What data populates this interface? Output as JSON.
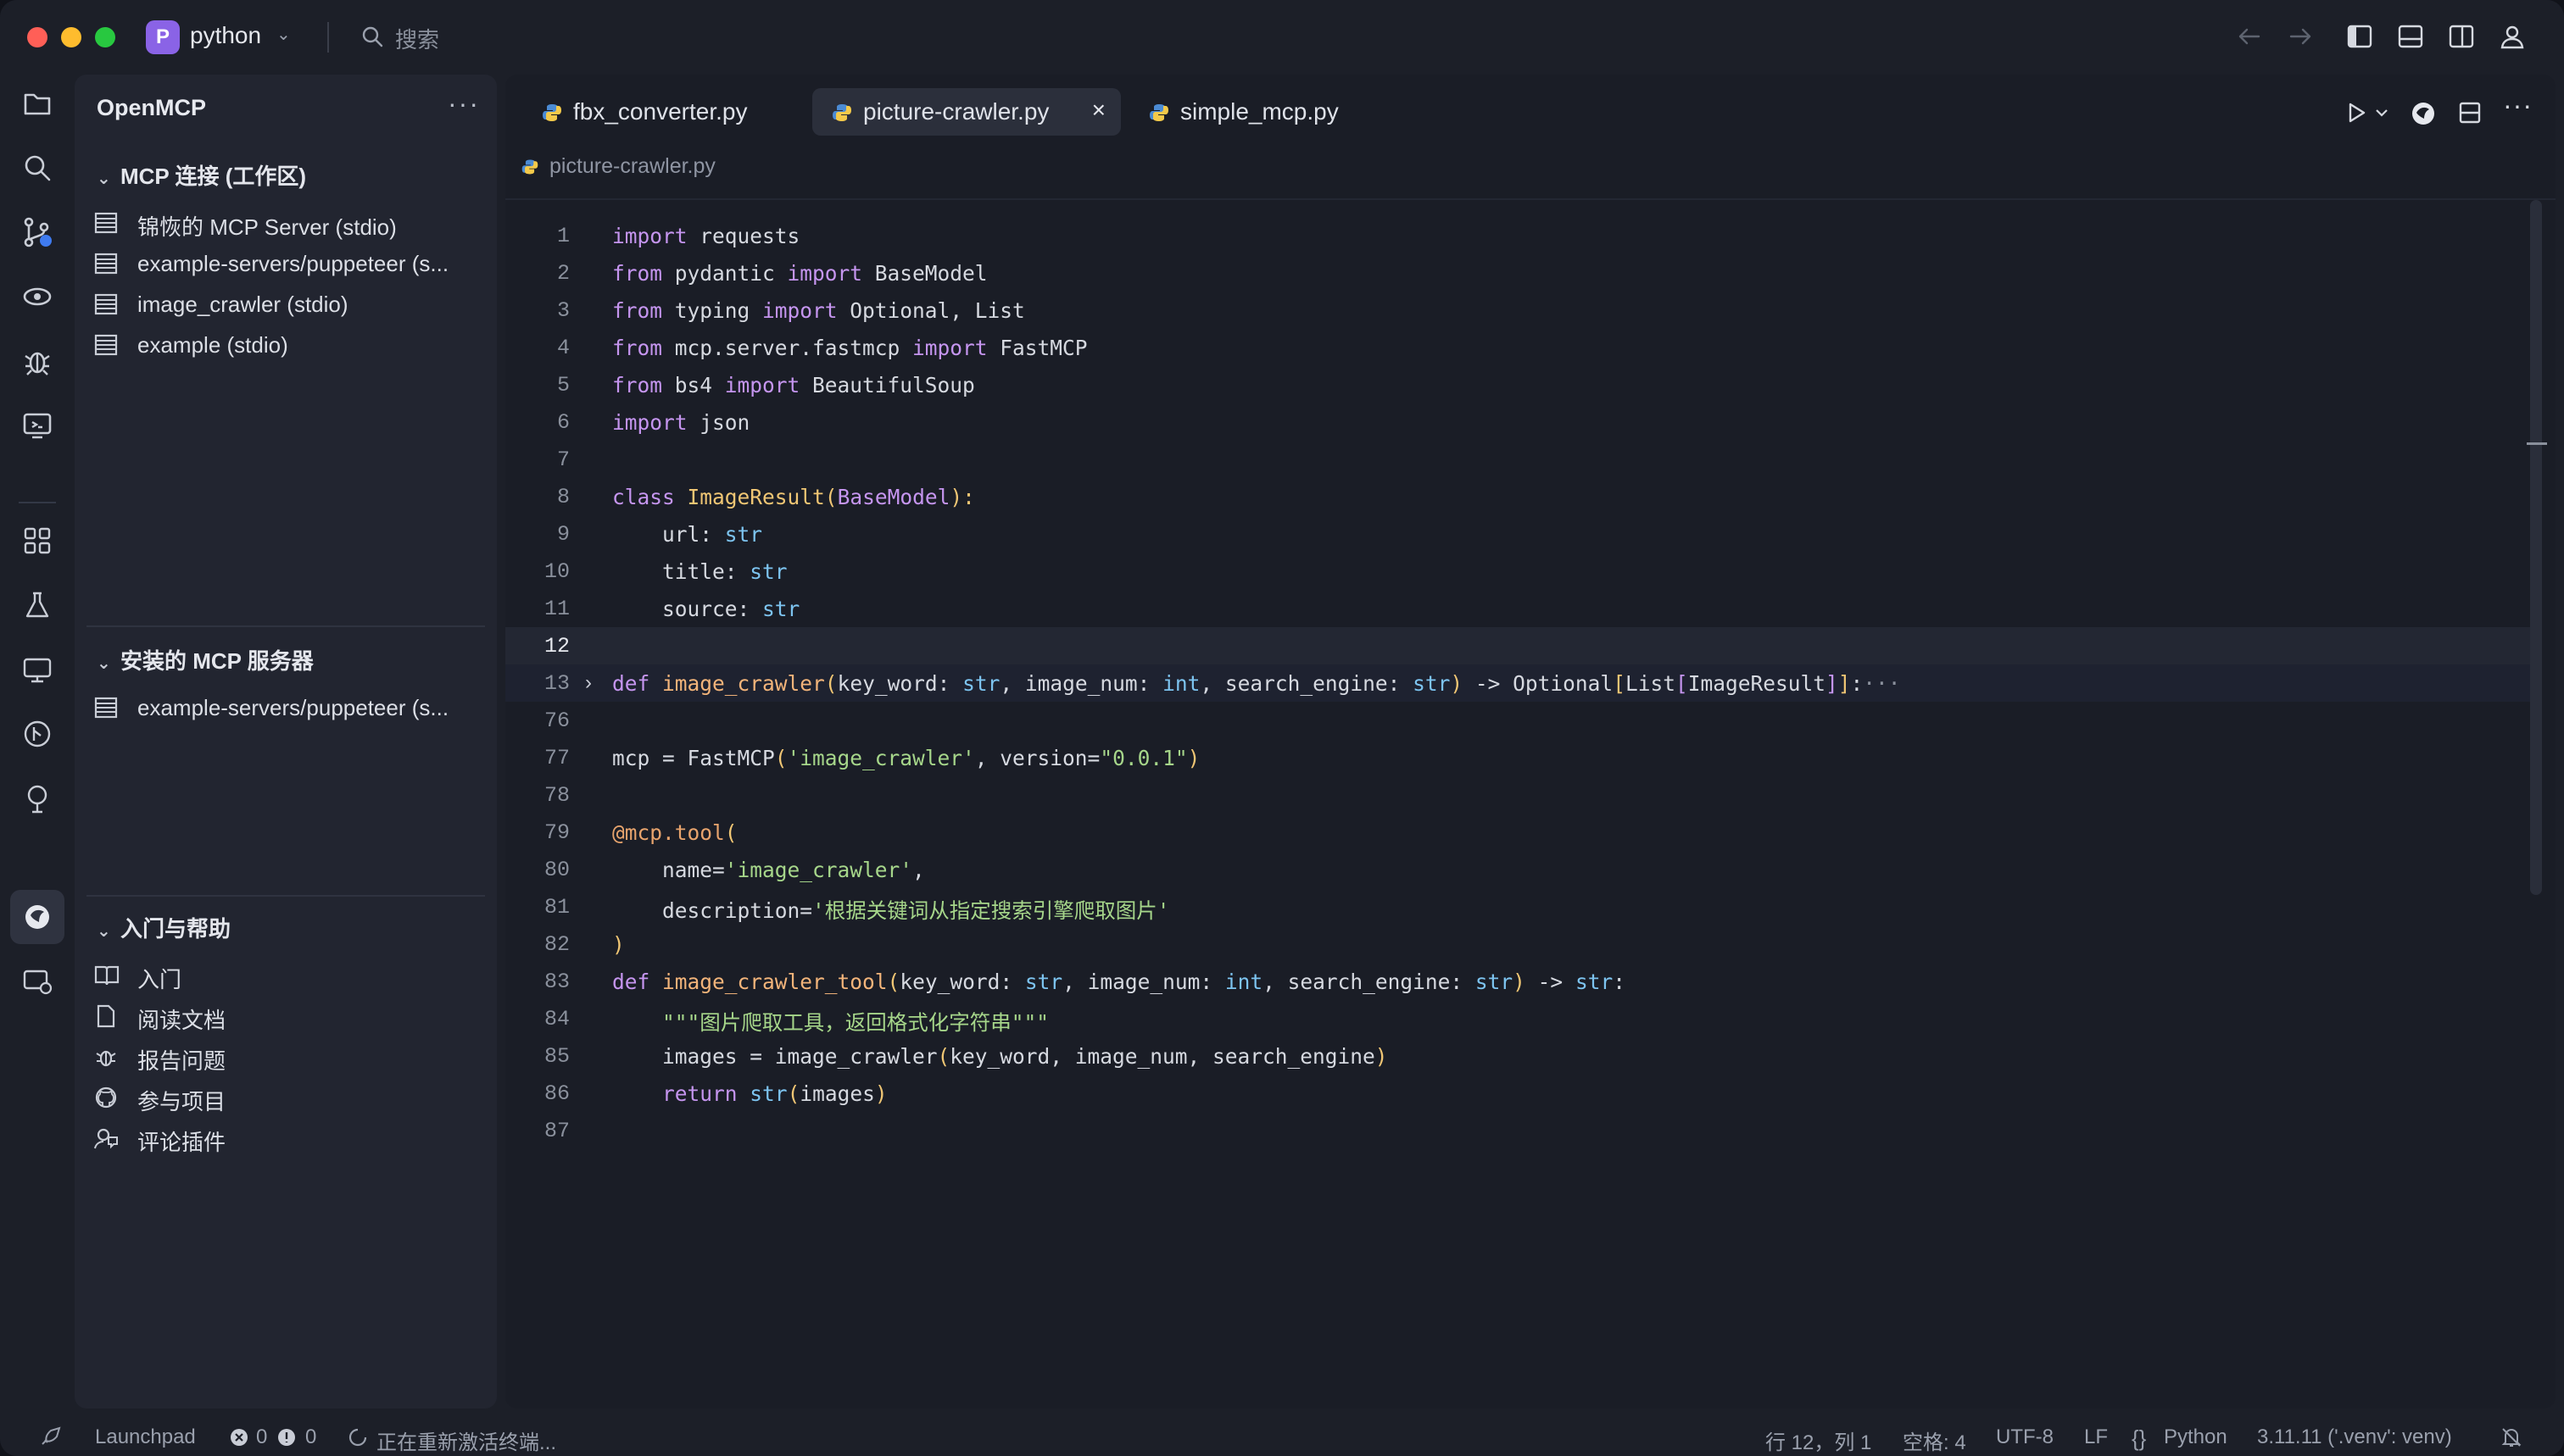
{
  "titlebar": {
    "project_initial": "P",
    "project_name": "python",
    "search_placeholder": "搜索"
  },
  "sidebar": {
    "title": "OpenMCP",
    "more": "···",
    "sections": {
      "connections": {
        "title": "MCP 连接 (工作区)",
        "items": [
          "锦恢的 MCP Server (stdio)",
          "example-servers/puppeteer (s...",
          "image_crawler (stdio)",
          "example (stdio)"
        ]
      },
      "installed": {
        "title": "安装的 MCP 服务器",
        "items": [
          "example-servers/puppeteer (s..."
        ]
      },
      "help": {
        "title": "入门与帮助",
        "items": [
          "入门",
          "阅读文档",
          "报告问题",
          "参与项目",
          "评论插件"
        ]
      }
    }
  },
  "editor": {
    "tabs": [
      {
        "label": "fbx_converter.py",
        "active": false
      },
      {
        "label": "picture-crawler.py",
        "active": true,
        "close": "×"
      },
      {
        "label": "simple_mcp.py",
        "active": false
      }
    ],
    "breadcrumb": "picture-crawler.py",
    "line_numbers": [
      "1",
      "2",
      "3",
      "4",
      "5",
      "6",
      "7",
      "8",
      "9",
      "10",
      "11",
      "12",
      "13",
      "76",
      "77",
      "78",
      "79",
      "80",
      "81",
      "82",
      "83",
      "84",
      "85",
      "86",
      "87"
    ],
    "code": {
      "l1": [
        "import",
        " requests"
      ],
      "l2": [
        "from",
        " pydantic ",
        "import",
        " BaseModel"
      ],
      "l3": [
        "from",
        " typing ",
        "import",
        " Optional, List"
      ],
      "l4": [
        "from",
        " mcp.server.fastmcp ",
        "import",
        " FastMCP"
      ],
      "l5": [
        "from",
        " bs4 ",
        "import",
        " BeautifulSoup"
      ],
      "l6": [
        "import",
        " json"
      ],
      "l8": [
        "class",
        " ",
        "ImageResult",
        "(",
        "BaseModel",
        "):"
      ],
      "l9": [
        "    url: ",
        "str"
      ],
      "l10": [
        "    title: ",
        "str"
      ],
      "l11": [
        "    source: ",
        "str"
      ],
      "l13": [
        "def",
        " ",
        "image_crawler",
        "(",
        "key_word: ",
        "str",
        ", image_num: ",
        "int",
        ", search_engine: ",
        "str",
        ")",
        " -> Optional",
        "[",
        "List",
        "[",
        "ImageResult",
        "]",
        "]",
        ":",
        "···"
      ],
      "l77": [
        "mcp = FastMCP",
        "(",
        "'image_crawler'",
        ", version=",
        "\"0.0.1\"",
        ")"
      ],
      "l79": [
        "@mcp.tool",
        "("
      ],
      "l80": [
        "    name=",
        "'image_crawler'",
        ","
      ],
      "l81": [
        "    description=",
        "'根据关键词从指定搜索引擎爬取图片'"
      ],
      "l82": [
        ")"
      ],
      "l83": [
        "def",
        " ",
        "image_crawler_tool",
        "(",
        "key_word: ",
        "str",
        ", image_num: ",
        "int",
        ", search_engine: ",
        "str",
        ")",
        " -> ",
        "str",
        ":"
      ],
      "l84": [
        "    ",
        "\"\"\"图片爬取工具，返回格式化字符串\"\"\""
      ],
      "l85": [
        "    images = image_crawler",
        "(",
        "key_word, image_num, search_engine",
        ")"
      ],
      "l86": [
        "    ",
        "return",
        " ",
        "str",
        "(",
        "images",
        ")"
      ]
    }
  },
  "statusbar": {
    "launchpad": "Launchpad",
    "errors": "0",
    "warnings": "0",
    "task": "正在重新激活终端...",
    "position": "行 12，列 1",
    "spaces": "空格: 4",
    "encoding": "UTF-8",
    "eol": "LF",
    "language": "Python",
    "interpreter": "3.11.11 ('.venv': venv)"
  },
  "colors": {
    "keyword": "#c595ef",
    "class": "#f0c674",
    "function": "#f2b47a",
    "type": "#7dc4f0",
    "string": "#a6d68a",
    "accent": "#8a63e6"
  }
}
